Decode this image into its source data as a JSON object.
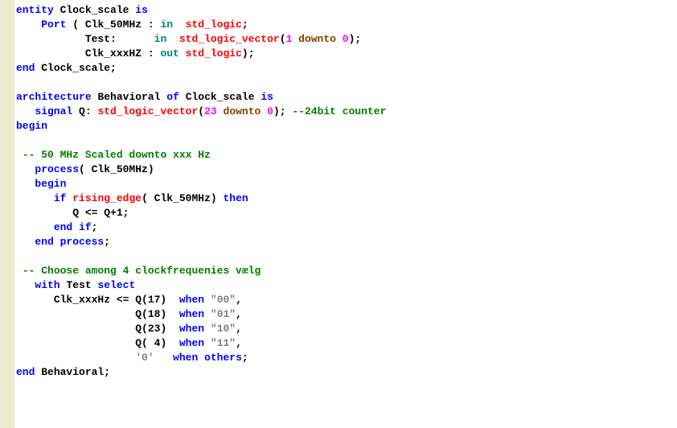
{
  "t": {
    "entity": "entity",
    "name": "Clock_scale",
    "is": "is",
    "port": "Port",
    "p1n": "Clk_50MHz",
    "p1d": "in",
    "p1t": "std_logic",
    "p2n": "Test",
    "p2d": "in",
    "p2t": "std_logic_vector",
    "p2r1": "1",
    "downto": "downto",
    "p2r2": "0",
    "p3n": "Clk_xxxHZ",
    "p3d": "out",
    "p3t": "std_logic",
    "end": "end",
    "arch": "architecture",
    "bhv": "Behavioral",
    "of": "of",
    "signal": "signal",
    "qn": "Q",
    "qt": "std_logic_vector",
    "qr1": "23",
    "qr2": "0",
    "c1": "--24bit counter",
    "begin": "begin",
    "c2": "-- 50 MHz Scaled downto xxx Hz",
    "process": "process",
    "pa": "Clk_50MHz",
    "if": "if",
    "re": "rising_edge",
    "rea": "Clk_50MHz",
    "then": "then",
    "qexpr": "Q <= Q+1;",
    "endif": "end",
    "ifword": "if",
    "endp": "end",
    "processw": "process",
    "c3": "-- Choose among 4 clockfrequenies vælg",
    "with": "with",
    "testw": "Test",
    "select": "select",
    "lhs": "Clk_xxxHz <= Q(17)",
    "when": "when",
    "s00": "\"00\"",
    "s01": "\"01\"",
    "s10": "\"10\"",
    "s11": "\"11\"",
    "q18": "Q(18)",
    "q23": "Q(23)",
    "q4": "Q( 4)",
    "zero": "'0'",
    "others": "others",
    "comma": ",",
    "semi": ";"
  }
}
